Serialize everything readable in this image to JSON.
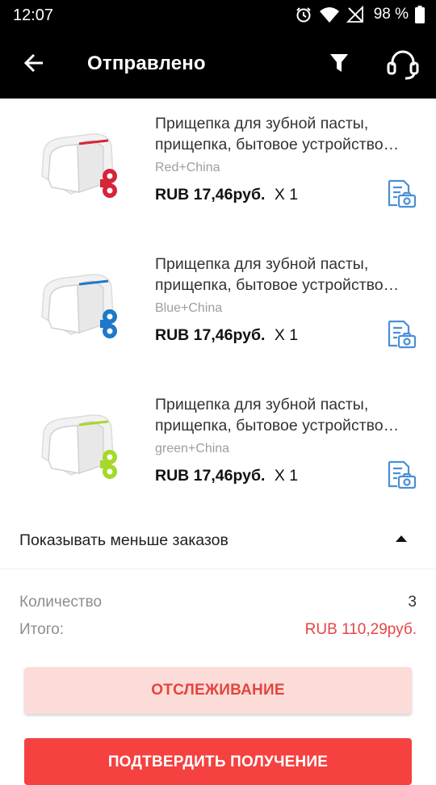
{
  "status_bar": {
    "time": "12:07",
    "battery": "98 %",
    "icons": [
      "alarm-icon",
      "wifi-icon",
      "no-signal-icon",
      "battery-icon"
    ]
  },
  "header": {
    "title": "Отправлено",
    "icons": [
      "back-arrow-icon",
      "filter-icon",
      "headset-icon"
    ]
  },
  "items": [
    {
      "title_line1": "Прищепка для зубной пасты,",
      "title_line2": "прищепка, бытовое устройство…",
      "variant": "Red+China",
      "price": "RUB 17,46руб.",
      "qty": "X 1",
      "accent": "#d6243a"
    },
    {
      "title_line1": "Прищепка для зубной пасты,",
      "title_line2": "прищепка, бытовое устройство…",
      "variant": "Blue+China",
      "price": "RUB 17,46руб.",
      "qty": "X 1",
      "accent": "#1e78c8"
    },
    {
      "title_line1": "Прищепка для зубной пасты,",
      "title_line2": "прищепка, бытовое устройство…",
      "variant": "green+China",
      "price": "RUB 17,46руб.",
      "qty": "X 1",
      "accent": "#a6d82a"
    }
  ],
  "toggle": {
    "label": "Показывать меньше заказов"
  },
  "summary": {
    "quantity_label": "Количество",
    "quantity_value": "3",
    "total_label": "Итого:",
    "total_value": "RUB 110,29руб."
  },
  "buttons": {
    "track_label": "ОТСЛЕЖИВАНИЕ",
    "confirm_label": "ПОДТВЕРДИТЬ ПОЛУЧЕНИЕ"
  },
  "colors": {
    "accent_red": "#f5413f",
    "track_bg": "#fcdcd9",
    "review_icon": "#4a8fd6"
  }
}
